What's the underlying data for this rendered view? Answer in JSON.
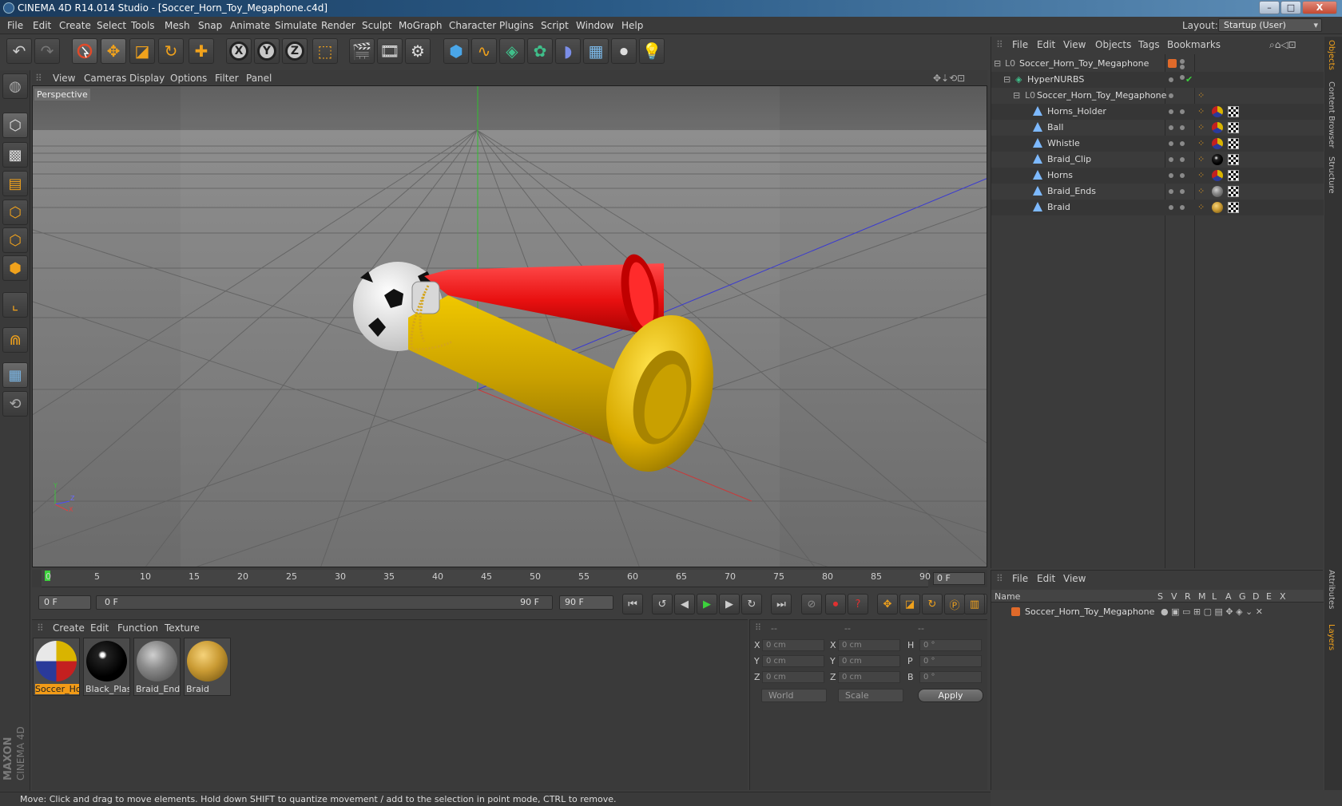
{
  "window": {
    "title": "CINEMA 4D R14.014 Studio - [Soccer_Horn_Toy_Megaphone.c4d]",
    "minimize": "–",
    "maximize": "□",
    "close": "X"
  },
  "menubar": {
    "items": [
      "File",
      "Edit",
      "Create",
      "Select",
      "Tools",
      "Mesh",
      "Snap",
      "Animate",
      "Simulate",
      "Render",
      "Sculpt",
      "MoGraph",
      "Character",
      "Plugins",
      "Script",
      "Window",
      "Help"
    ],
    "layout_label": "Layout:",
    "layout_value": "Startup (User)"
  },
  "toolbar": {
    "icons": [
      "undo-icon",
      "redo-icon",
      "live-selection-icon",
      "move-icon",
      "scale-icon",
      "rotate-icon",
      "recent-tool-icon",
      "x-axis-lock-icon",
      "y-axis-lock-icon",
      "z-axis-lock-icon",
      "coordinate-system-icon",
      "render-view-icon",
      "render-picture-viewer-icon",
      "render-settings-icon",
      "cube-primitive-icon",
      "spline-pen-icon",
      "nurbs-icon",
      "array-icon",
      "deformer-icon",
      "floor-icon",
      "camera-icon",
      "light-icon"
    ],
    "x": "X",
    "y": "Y",
    "z": "Z"
  },
  "left_tools": [
    "make-editable-icon",
    "model-mode-icon",
    "texture-mode-icon",
    "workplane-icon",
    "points-mode-icon",
    "edges-mode-icon",
    "polygons-mode-icon",
    "axis-mode-icon",
    "magnet-icon",
    "snap-grid-icon",
    "locked-workplane-icon"
  ],
  "brand": {
    "line1": "MAXON",
    "line2": "CINEMA 4D"
  },
  "viewport": {
    "menu": [
      "View",
      "Cameras",
      "Display",
      "Options",
      "Filter",
      "Panel"
    ],
    "label": "Perspective",
    "axis_y": "Y",
    "axis_z": "Z",
    "axis_x": "X"
  },
  "timeline": {
    "ticks": [
      "0",
      "5",
      "10",
      "15",
      "20",
      "25",
      "30",
      "35",
      "40",
      "45",
      "50",
      "55",
      "60",
      "65",
      "70",
      "75",
      "80",
      "85",
      "90"
    ],
    "current_frame": "0 F"
  },
  "transport": {
    "start_field": "0 F",
    "range_start": "0 F",
    "range_end": "90 F",
    "end_field": "90 F"
  },
  "material_manager": {
    "menu": [
      "Create",
      "Edit",
      "Function",
      "Texture"
    ],
    "materials": [
      {
        "name": "Soccer_Hor",
        "selected": true
      },
      {
        "name": "Black_Plast",
        "selected": false
      },
      {
        "name": "Braid_Ends",
        "selected": false
      },
      {
        "name": "Braid",
        "selected": false
      }
    ]
  },
  "coordinates": {
    "head": [
      "--",
      "--",
      "--"
    ],
    "labels_left": [
      "X",
      "Y",
      "Z"
    ],
    "labels_mid": [
      "X",
      "Y",
      "Z"
    ],
    "labels_right": [
      "H",
      "P",
      "B"
    ],
    "pos": [
      "0 cm",
      "0 cm",
      "0 cm"
    ],
    "size": [
      "0 cm",
      "0 cm",
      "0 cm"
    ],
    "rot": [
      "0 °",
      "0 °",
      "0 °"
    ],
    "mode": "World",
    "scale_mode": "Scale",
    "apply": "Apply"
  },
  "statusbar": {
    "text": "Move: Click and drag to move elements. Hold down SHIFT to quantize movement / add to the selection in point mode, CTRL to remove."
  },
  "object_manager": {
    "menu": [
      "File",
      "Edit",
      "View",
      "Objects",
      "Tags",
      "Bookmarks"
    ],
    "objects": [
      {
        "name": "Soccer_Horn_Toy_Megaphone",
        "level": 0
      },
      {
        "name": "HyperNURBS",
        "level": 1
      },
      {
        "name": "Soccer_Horn_Toy_Megaphone",
        "level": 2
      },
      {
        "name": "Horns_Holder",
        "level": 3
      },
      {
        "name": "Ball",
        "level": 3
      },
      {
        "name": "Whistle",
        "level": 3
      },
      {
        "name": "Braid_Clip",
        "level": 3
      },
      {
        "name": "Horns",
        "level": 3
      },
      {
        "name": "Braid_Ends",
        "level": 3
      },
      {
        "name": "Braid",
        "level": 3
      }
    ]
  },
  "side_tabs": [
    "Objects",
    "Content Browser",
    "Structure",
    "Attributes",
    "Layers"
  ],
  "layer_manager": {
    "menu": [
      "File",
      "Edit",
      "View"
    ],
    "columns": [
      "Name",
      "S",
      "V",
      "R",
      "M",
      "L",
      "A",
      "G",
      "D",
      "E",
      "X"
    ],
    "layer": "Soccer_Horn_Toy_Megaphone"
  }
}
